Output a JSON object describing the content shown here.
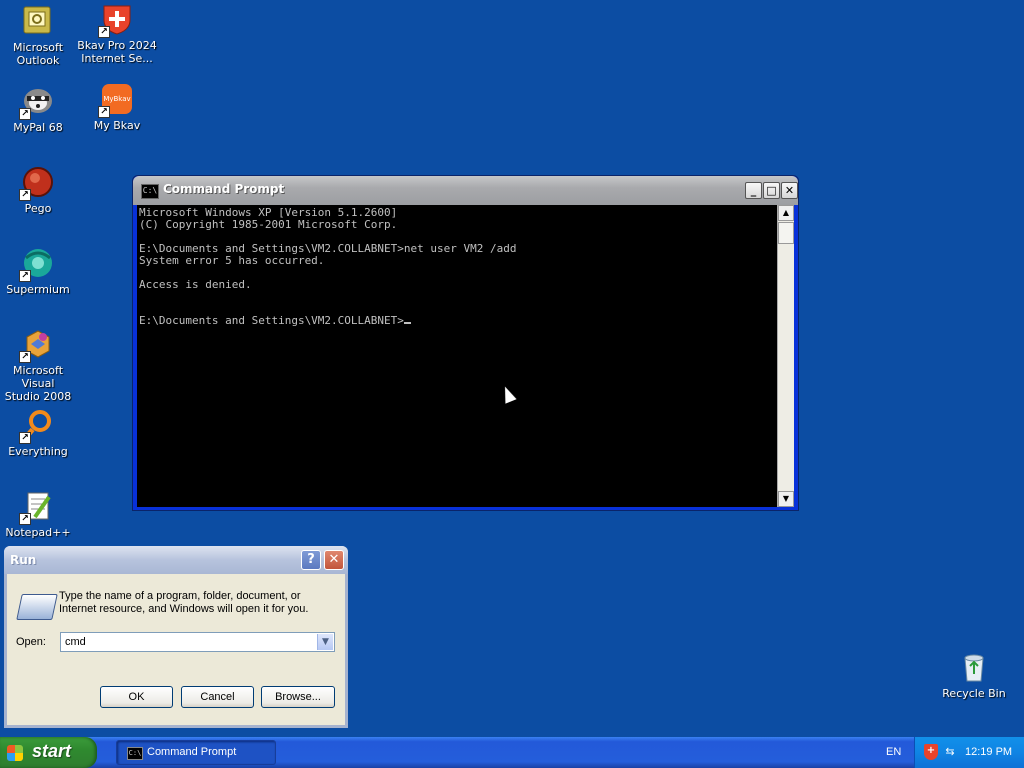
{
  "desktop": {
    "icons": [
      {
        "label": "Microsoft\nOutlook"
      },
      {
        "label": "Bkav Pro 2024\nInternet Se..."
      },
      {
        "label": "MyPal 68"
      },
      {
        "label": "My Bkav"
      },
      {
        "label": "Pego"
      },
      {
        "label": "Supermium"
      },
      {
        "label": "Microsoft Visual\nStudio 2008"
      },
      {
        "label": "Everything"
      },
      {
        "label": "Notepad++"
      },
      {
        "label": "Recycle Bin"
      }
    ],
    "icon_badges": {
      "my_bkav": "MyBkav"
    }
  },
  "cmd_window": {
    "title": "Command Prompt",
    "icon_text": "C:\\",
    "buttons": {
      "minimize": "_",
      "maximize": "□",
      "close": "✕"
    },
    "lines": [
      "Microsoft Windows XP [Version 5.1.2600]",
      "(C) Copyright 1985-2001 Microsoft Corp.",
      "",
      "E:\\Documents and Settings\\VM2.COLLABNET>net user VM2 /add",
      "System error 5 has occurred.",
      "",
      "Access is denied.",
      "",
      "",
      "E:\\Documents and Settings\\VM2.COLLABNET>"
    ]
  },
  "run_dialog": {
    "title": "Run",
    "help": "?",
    "close": "✕",
    "description": "Type the name of a program, folder, document, or\nInternet resource, and Windows will open it for you.",
    "open_label": "Open:",
    "open_value": "cmd",
    "ok": "OK",
    "cancel": "Cancel",
    "browse": "Browse..."
  },
  "taskbar": {
    "start": "start",
    "task_button": "Command Prompt",
    "language": "EN",
    "clock": "12:19 PM"
  },
  "colors": {
    "desktop": "#0c4da3",
    "taskbar": "#245edb",
    "start_green": "#2f8a2f",
    "console_bg": "#000000",
    "console_fg": "#c0c0c0"
  }
}
